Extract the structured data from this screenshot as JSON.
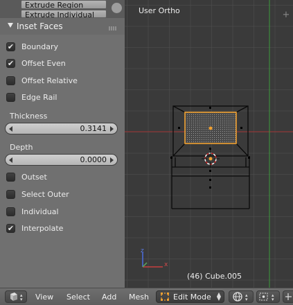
{
  "operator_list": {
    "items": [
      "Extrude Region",
      "Extrude Individual"
    ]
  },
  "panel": {
    "title": "Inset Faces",
    "options": [
      {
        "label": "Boundary",
        "checked": true
      },
      {
        "label": "Offset Even",
        "checked": true
      },
      {
        "label": "Offset Relative",
        "checked": false
      },
      {
        "label": "Edge Rail",
        "checked": false
      }
    ],
    "thickness": {
      "label": "Thickness",
      "value": "0.3141"
    },
    "depth": {
      "label": "Depth",
      "value": "0.0000"
    },
    "options2": [
      {
        "label": "Outset",
        "checked": false
      },
      {
        "label": "Select Outer",
        "checked": false
      },
      {
        "label": "Individual",
        "checked": false
      },
      {
        "label": "Interpolate",
        "checked": true
      }
    ]
  },
  "viewport": {
    "view_name": "User Ortho",
    "object_info": "(46) Cube.005",
    "axis_x_label": "x",
    "axis_z_label": "z",
    "x_axis_color": "#a03232",
    "y_axis_color": "#3c9a3c",
    "selection_color": "#f0a030"
  },
  "header": {
    "menus": [
      "View",
      "Select",
      "Add",
      "Mesh"
    ],
    "mode": "Edit Mode",
    "editor_type_icon": "cube-icon",
    "shading_icon": "sphere-icon",
    "pivot_icon": "pivot-icon"
  },
  "check_mark": "✔"
}
